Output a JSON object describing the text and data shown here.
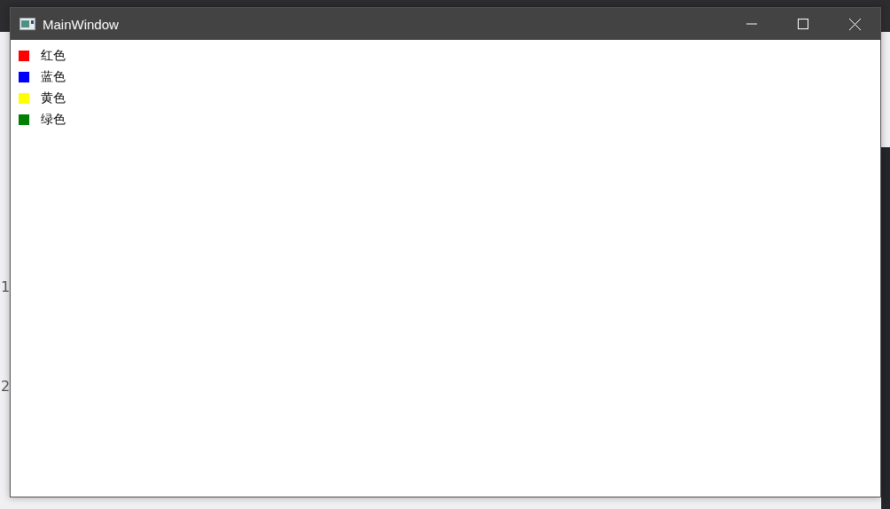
{
  "background": {
    "numbers": [
      "1",
      "2"
    ]
  },
  "window": {
    "title": "MainWindow"
  },
  "legend": [
    {
      "label": "红色",
      "color": "#ff0000"
    },
    {
      "label": "蓝色",
      "color": "#0000ff"
    },
    {
      "label": "黄色",
      "color": "#ffff00"
    },
    {
      "label": "绿色",
      "color": "#008000"
    }
  ]
}
